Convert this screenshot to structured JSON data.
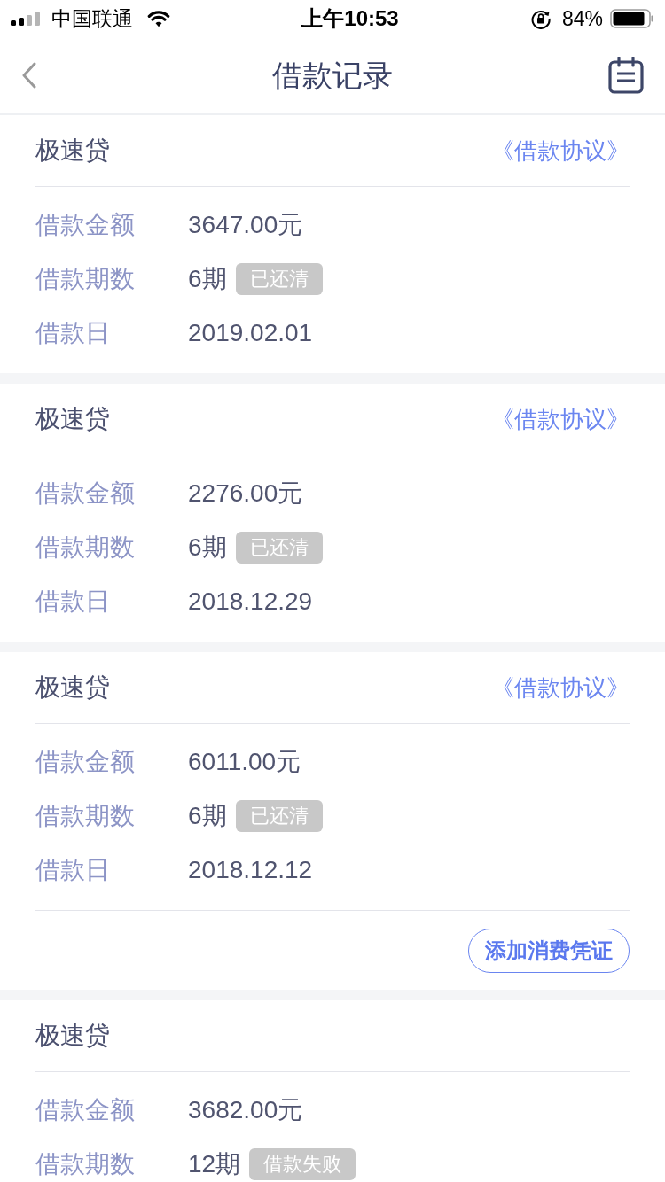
{
  "status_bar": {
    "carrier": "中国联通",
    "time": "上午10:53",
    "battery": "84%"
  },
  "nav": {
    "title": "借款记录"
  },
  "loans": [
    {
      "product": "极速贷",
      "agreement_link": "《借款协议》",
      "fields": [
        {
          "label": "借款金额",
          "value": "3647.00元"
        },
        {
          "label": "借款期数",
          "value": "6期",
          "badge": "已还清"
        },
        {
          "label": "借款日",
          "value": "2019.02.01"
        }
      ]
    },
    {
      "product": "极速贷",
      "agreement_link": "《借款协议》",
      "fields": [
        {
          "label": "借款金额",
          "value": "2276.00元"
        },
        {
          "label": "借款期数",
          "value": "6期",
          "badge": "已还清"
        },
        {
          "label": "借款日",
          "value": "2018.12.29"
        }
      ]
    },
    {
      "product": "极速贷",
      "agreement_link": "《借款协议》",
      "fields": [
        {
          "label": "借款金额",
          "value": "6011.00元"
        },
        {
          "label": "借款期数",
          "value": "6期",
          "badge": "已还清"
        },
        {
          "label": "借款日",
          "value": "2018.12.12"
        }
      ],
      "action_button": "添加消费凭证"
    },
    {
      "product": "极速贷",
      "fields": [
        {
          "label": "借款金额",
          "value": "3682.00元"
        },
        {
          "label": "借款期数",
          "value": "12期",
          "badge": "借款失败"
        }
      ]
    }
  ]
}
